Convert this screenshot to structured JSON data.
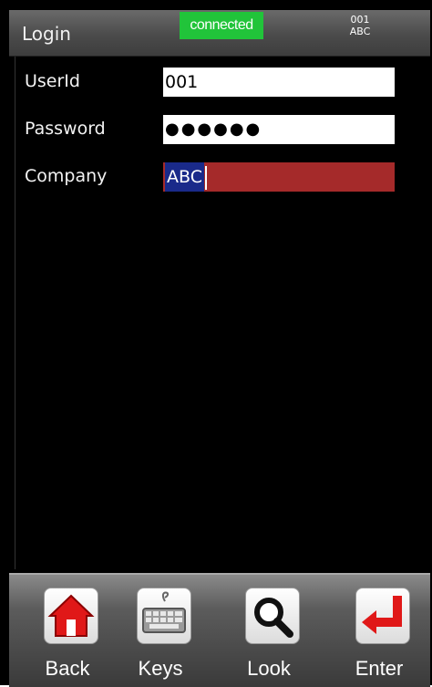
{
  "header": {
    "title": "Login",
    "status": "connected",
    "user_id": "001",
    "company": "ABC"
  },
  "form": {
    "rows": [
      {
        "label": "UserId",
        "value": "001"
      },
      {
        "label": "Password",
        "value": "●●●●●●"
      },
      {
        "label": "Company",
        "value": "ABC"
      }
    ]
  },
  "toolbar": {
    "buttons": [
      {
        "label": "Back",
        "icon": "home-icon"
      },
      {
        "label": "Keys",
        "icon": "keyboard-icon"
      },
      {
        "label": "Look",
        "icon": "magnifier-icon"
      },
      {
        "label": "Enter",
        "icon": "enter-arrow-icon"
      }
    ]
  },
  "colors": {
    "connected": "#21c43a",
    "active_field": "#a52a2a",
    "selection": "#1a2a8a"
  }
}
